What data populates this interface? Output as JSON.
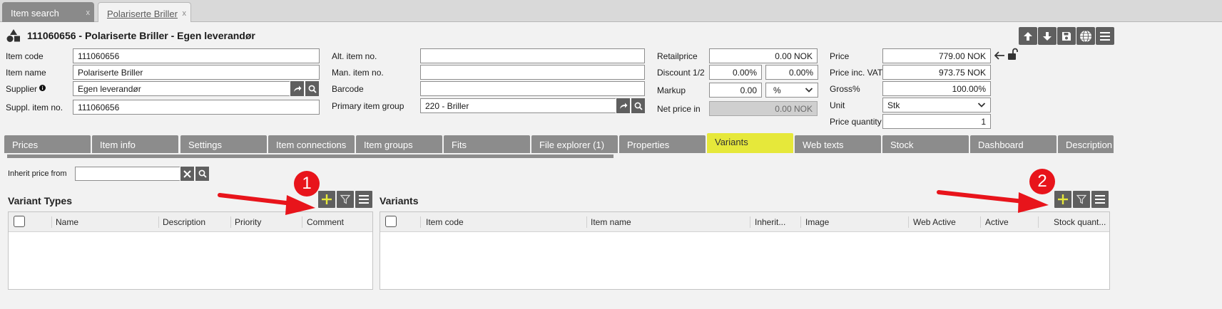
{
  "window_tabs": [
    {
      "label": "Item search",
      "close": "x"
    },
    {
      "label": "Polariserte Briller",
      "close": "x"
    }
  ],
  "header": {
    "title": "111060656 - Polariserte Briller - Egen leverandør",
    "toolbar_icons": [
      "arrow-up-icon",
      "arrow-down-icon",
      "save-icon",
      "globe-icon",
      "menu-icon"
    ]
  },
  "form": {
    "item_code": {
      "label": "Item code",
      "value": "111060656"
    },
    "item_name": {
      "label": "Item name",
      "value": "Polariserte Briller"
    },
    "supplier": {
      "label": "Supplier",
      "value": "Egen leverandør"
    },
    "suppl_item_no": {
      "label": "Suppl. item no.",
      "value": "111060656"
    },
    "alt_item_no": {
      "label": "Alt. item no.",
      "value": ""
    },
    "man_item_no": {
      "label": "Man. item no.",
      "value": ""
    },
    "barcode": {
      "label": "Barcode",
      "value": ""
    },
    "primary_item_group": {
      "label": "Primary item group",
      "value": "220 - Briller"
    },
    "retailprice": {
      "label": "Retailprice",
      "value": "0.00 NOK"
    },
    "discount": {
      "label": "Discount 1/2",
      "value1": "0.00%",
      "value2": "0.00%"
    },
    "markup": {
      "label": "Markup",
      "value": "0.00",
      "unit": "%"
    },
    "net_price_in": {
      "label": "Net price in",
      "value": "0.00 NOK"
    },
    "price": {
      "label": "Price",
      "value": "779.00 NOK"
    },
    "price_inc_vat": {
      "label": "Price inc. VAT",
      "value": "973.75 NOK"
    },
    "gross": {
      "label": "Gross%",
      "value": "100.00%"
    },
    "unit": {
      "label": "Unit",
      "value": "Stk"
    },
    "price_quantity": {
      "label": "Price quantity",
      "value": "1"
    }
  },
  "tabs": [
    {
      "label": "Prices"
    },
    {
      "label": "Item info"
    },
    {
      "label": "Settings"
    },
    {
      "label": "Item connections"
    },
    {
      "label": "Item groups"
    },
    {
      "label": "Fits"
    },
    {
      "label": "File explorer (1)"
    },
    {
      "label": "Properties"
    },
    {
      "label": "Variants",
      "active": true
    },
    {
      "label": "Web texts"
    },
    {
      "label": "Stock"
    },
    {
      "label": "Dashboard"
    },
    {
      "label": "Description"
    }
  ],
  "inherit_price_from": {
    "label": "Inherit price from",
    "value": ""
  },
  "variant_types": {
    "title": "Variant Types",
    "columns": [
      "Name",
      "Description",
      "Priority",
      "Comment"
    ]
  },
  "variants": {
    "title": "Variants",
    "columns": [
      "Item code",
      "Item name",
      "Inherit...",
      "Image",
      "Web Active",
      "Active",
      "Stock quant..."
    ]
  },
  "annotations": [
    {
      "number": "1"
    },
    {
      "number": "2"
    }
  ],
  "colors": {
    "accent_yellow": "#e6e83a",
    "button_gray": "#5f5f5f",
    "tab_gray": "#8c8c8c",
    "annotation_red": "#e8141b"
  }
}
